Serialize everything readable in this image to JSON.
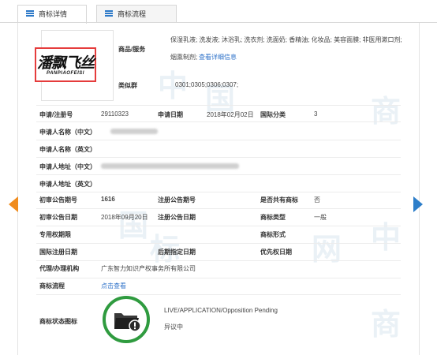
{
  "tabs": [
    {
      "label": "商标详情",
      "active": true
    },
    {
      "label": "商标流程",
      "active": false
    }
  ],
  "logo": {
    "cn": "潘飘飞丝",
    "en": "PANPIAOFEISI"
  },
  "watermark": [
    "中",
    "国",
    "商",
    "标",
    "网"
  ],
  "goods": {
    "label": "商品/服务",
    "text_line1": "保湿乳液; 洗发液; 沐浴乳; 洗衣剂; 洗面奶; 香精油; 化妆品; 美容面膜; 非医用漱口剂;",
    "text_line2_prefix": "烟熏制剂;",
    "view_link": "查看详细信息"
  },
  "similar_group": {
    "label": "类似群",
    "value": "0301;0305;0306;0307;"
  },
  "fields": {
    "reg_no": {
      "label": "申请/注册号",
      "value": "29110323"
    },
    "apply_date": {
      "label": "申请日期",
      "value": "2018年02月02日"
    },
    "intl_class": {
      "label": "国际分类",
      "value": "3"
    },
    "applicant_cn": {
      "label": "申请人名称（中文）"
    },
    "applicant_en": {
      "label": "申请人名称（英文）"
    },
    "address_cn": {
      "label": "申请人地址（中文）"
    },
    "address_en": {
      "label": "申请人地址（英文）"
    },
    "prelim_pub_no": {
      "label": "初审公告期号",
      "value": "1616"
    },
    "reg_pub_no": {
      "label": "注册公告期号",
      "value": ""
    },
    "shared": {
      "label": "是否共有商标",
      "value": "否"
    },
    "prelim_pub_date": {
      "label": "初审公告日期",
      "value": "2018年09月20日"
    },
    "reg_pub_date": {
      "label": "注册公告日期",
      "value": ""
    },
    "tm_type": {
      "label": "商标类型",
      "value": "一般"
    },
    "exclusive_period": {
      "label": "专用权期限",
      "value": ""
    },
    "tm_form": {
      "label": "商标形式",
      "value": ""
    },
    "intl_reg_date": {
      "label": "国际注册日期",
      "value": ""
    },
    "later_designation": {
      "label": "后期指定日期",
      "value": ""
    },
    "priority_date": {
      "label": "优先权日期",
      "value": ""
    },
    "agent": {
      "label": "代理/办理机构",
      "value": "广东智力知识产权事务所有限公司"
    },
    "process": {
      "label": "商标流程",
      "link": "点击查看"
    }
  },
  "status": {
    "label": "商标状态图标",
    "en": "LIVE/APPLICATION/Opposition Pending",
    "cn": "异议中",
    "icon": "folder-alert-icon",
    "ring_color": "#2f9b3f"
  },
  "colors": {
    "accent": "#2e72c9",
    "prev_arrow": "#f08c1e",
    "next_arrow": "#2d7ec9",
    "logo_border": "#e53c3c"
  }
}
